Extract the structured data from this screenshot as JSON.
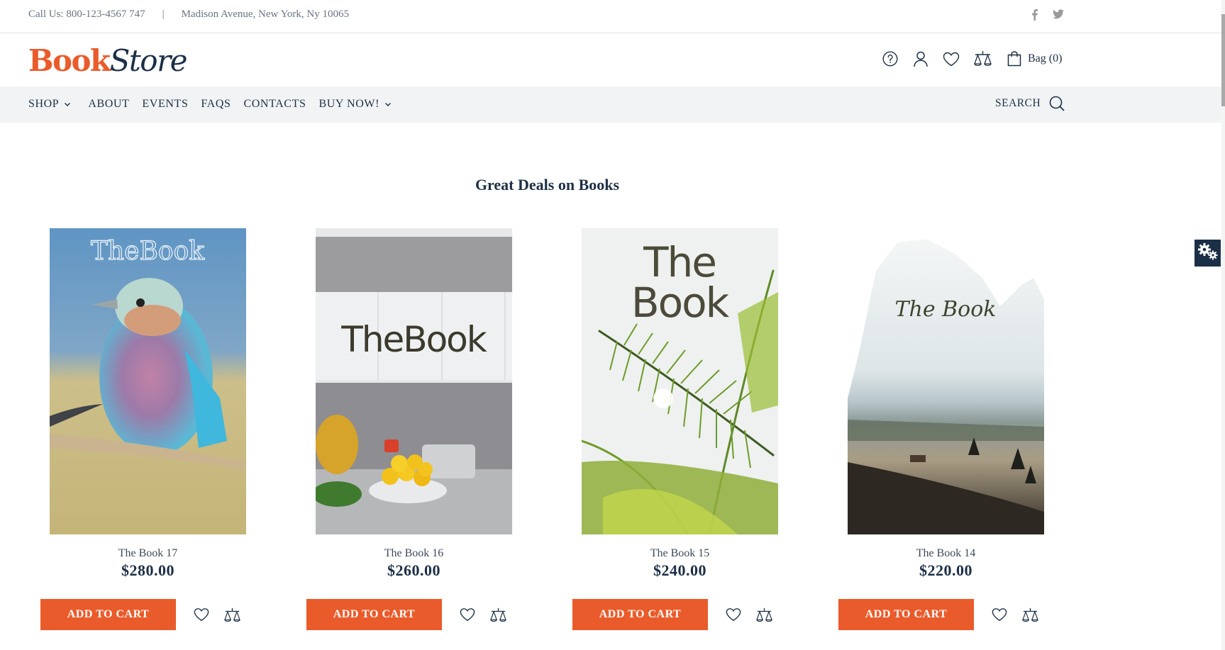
{
  "topbar": {
    "phone": "Call Us: 800-123-4567 747",
    "separator": "|",
    "address": "Madison Avenue, New York, Ny 10065",
    "social": [
      "facebook-icon",
      "twitter-icon"
    ]
  },
  "header": {
    "logo_part1": "Book",
    "logo_part2": "Store",
    "icons": [
      "help-icon",
      "user-icon",
      "heart-icon",
      "compare-icon",
      "bag-icon"
    ],
    "bag_label": "Bag (0)"
  },
  "nav": {
    "items": [
      {
        "label": "SHOP",
        "has_dropdown": true
      },
      {
        "label": "ABOUT",
        "has_dropdown": false
      },
      {
        "label": "EVENTS",
        "has_dropdown": false
      },
      {
        "label": "FAQS",
        "has_dropdown": false
      },
      {
        "label": "CONTACTS",
        "has_dropdown": false
      },
      {
        "label": "BUY NOW!",
        "has_dropdown": true
      }
    ],
    "search_label": "SEARCH"
  },
  "section": {
    "title": "Great Deals on Books"
  },
  "products": [
    {
      "name": "The Book 17",
      "price": "$280.00",
      "cover_text": "TheBook",
      "cover_theme": "bird",
      "button": "ADD TO CART"
    },
    {
      "name": "The Book 16",
      "price": "$260.00",
      "cover_text": "TheBook",
      "cover_theme": "kitchen",
      "button": "ADD TO CART"
    },
    {
      "name": "The Book 15",
      "price": "$240.00",
      "cover_text": "The Book",
      "cover_theme": "palm",
      "button": "ADD TO CART"
    },
    {
      "name": "The Book 14",
      "price": "$220.00",
      "cover_text": "The Book",
      "cover_theme": "mountain",
      "button": "ADD TO CART"
    }
  ],
  "colors": {
    "accent": "#ea5b2b",
    "navy": "#1b2f47",
    "nav_bg": "#f1f3f5"
  },
  "settings_button": "settings-gears-icon"
}
